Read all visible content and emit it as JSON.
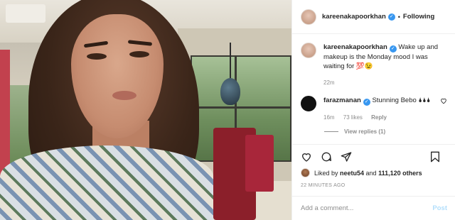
{
  "header": {
    "username": "kareenakapoorkhan",
    "separator": "•",
    "follow_label": "Following"
  },
  "caption": {
    "username": "kareenakapoorkhan",
    "text": "Wake up and makeup is the Monday mood I was waiting for 💯😉",
    "time": "22m"
  },
  "comments": [
    {
      "username": "farazmanan",
      "text": "Stunning Bebo 🌢🌢🌢",
      "time": "16m",
      "likes": "73 likes",
      "reply_label": "Reply",
      "view_replies": "View replies (1)"
    }
  ],
  "likes": {
    "prefix": "Liked by ",
    "user": "neetu54",
    "middle": " and ",
    "count": "111,120 others"
  },
  "post_time": "22 MINUTES AGO",
  "add_comment": {
    "placeholder": "Add a comment...",
    "post_label": "Post"
  },
  "colors": {
    "verified": "#3897f0",
    "post_disabled": "#b2dffc",
    "muted": "#8e8e8e"
  },
  "icons": [
    "heart-icon",
    "comment-icon",
    "share-icon",
    "bookmark-icon",
    "verified-badge-icon"
  ]
}
